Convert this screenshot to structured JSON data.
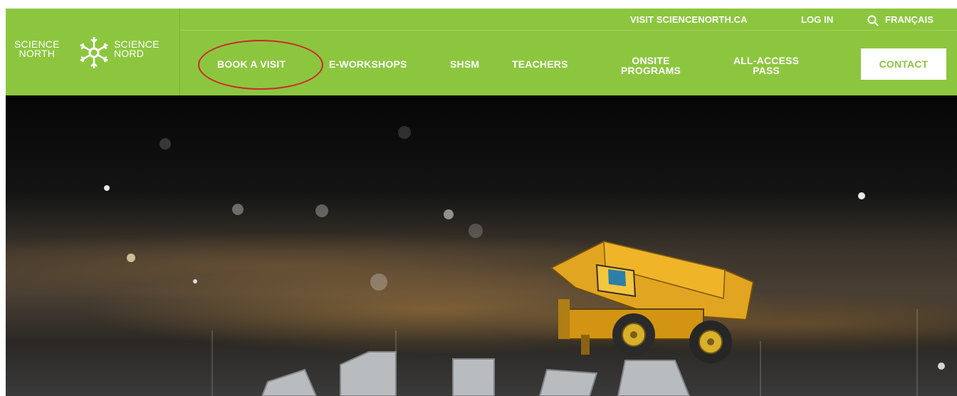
{
  "logo": {
    "left_line1": "SCIENCE",
    "left_line2": "NORTH",
    "right_line1": "SCIENCE",
    "right_line2": "NORD"
  },
  "utility": {
    "visit": "VISIT SCIENCENORTH.CA",
    "login": "LOG IN",
    "language": "FRANÇAIS"
  },
  "nav": {
    "book_visit": "BOOK A VISIT",
    "e_workshops": "E-WORKSHOPS",
    "shsm": "SHSM",
    "teachers": "TEACHERS",
    "onsite_line1": "ONSITE",
    "onsite_line2": "PROGRAMS",
    "pass_line1": "ALL-ACCESS",
    "pass_line2": "PASS",
    "contact": "CONTACT"
  },
  "colors": {
    "brand_green": "#8cc63f",
    "highlight_red": "#d0252c",
    "white": "#ffffff"
  },
  "icons": {
    "logo": "snowflake-logo-icon",
    "search": "search-icon"
  }
}
